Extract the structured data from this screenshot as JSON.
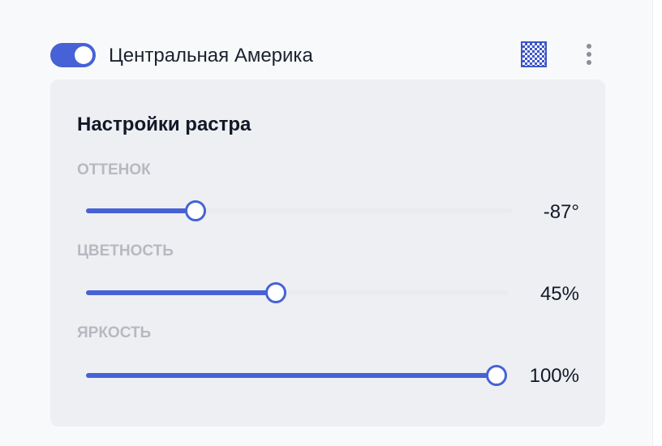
{
  "layer": {
    "enabled": true,
    "name": "Центральная Америка",
    "icons": {
      "raster": "raster-checkerboard-icon",
      "more": "more-vertical-icon"
    }
  },
  "raster_settings": {
    "title": "Настройки растра",
    "sliders": [
      {
        "key": "hue",
        "label": "ОТТЕНОК",
        "value_text": "-87°",
        "level": 0.256
      },
      {
        "key": "saturation",
        "label": "ЦВЕТНОСТЬ",
        "value_text": "45%",
        "level": 0.45
      },
      {
        "key": "brightness",
        "label": "ЯРКОСТЬ",
        "value_text": "100%",
        "level": 1.0
      }
    ]
  },
  "colors": {
    "accent": "#4662d6",
    "track": "#eaebee",
    "card_background": "#eeeff2",
    "label": "#b6b9c0",
    "text": "#111827"
  }
}
